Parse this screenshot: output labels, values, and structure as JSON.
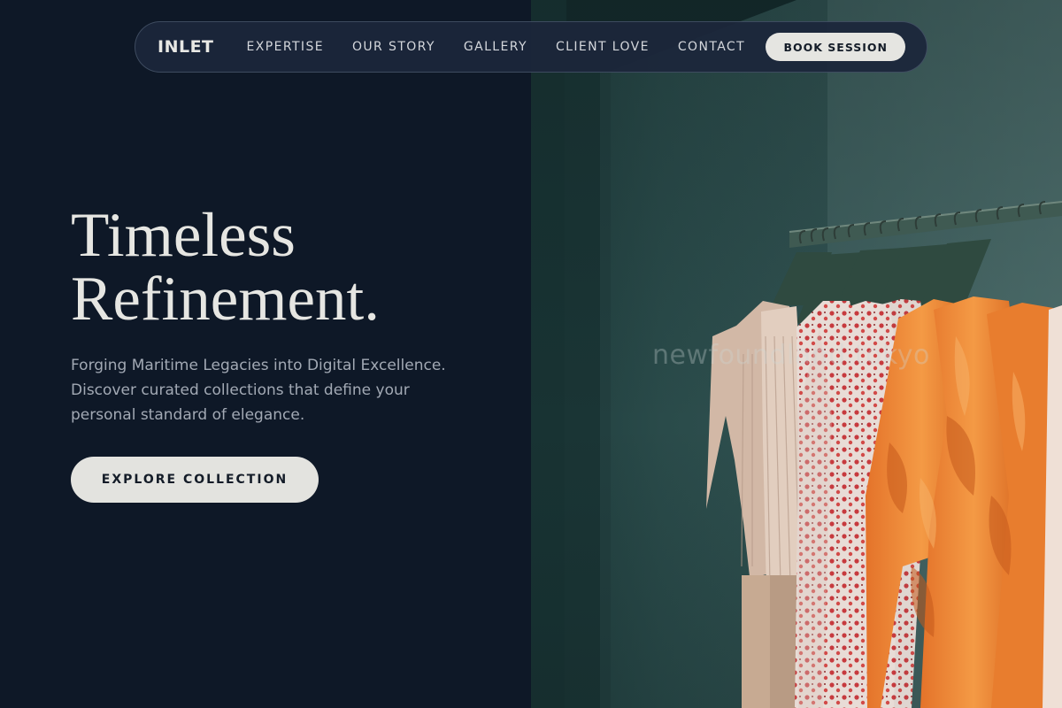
{
  "nav": {
    "logo": "INLET",
    "links": [
      "EXPERTISE",
      "OUR STORY",
      "GALLERY",
      "CLIENT LOVE",
      "CONTACT"
    ],
    "cta": "BOOK SESSION"
  },
  "hero": {
    "title_line1": "Timeless",
    "title_line2": "Refinement.",
    "description": "Forging Maritime Legacies into Digital Excellence. Discover curated collections that define your personal standard of elegance.",
    "button": "EXPLORE COLLECTION"
  },
  "image": {
    "subject": "clothing rack with garments on hangers",
    "watermark": "newfoundland.tokyo"
  },
  "colors": {
    "background": "#0e1827",
    "nav_background": "#1c263a",
    "text_light": "#e6e6e2",
    "text_muted": "#a2a9b4",
    "button_bg": "#e3e3df",
    "button_text": "#141c28"
  }
}
